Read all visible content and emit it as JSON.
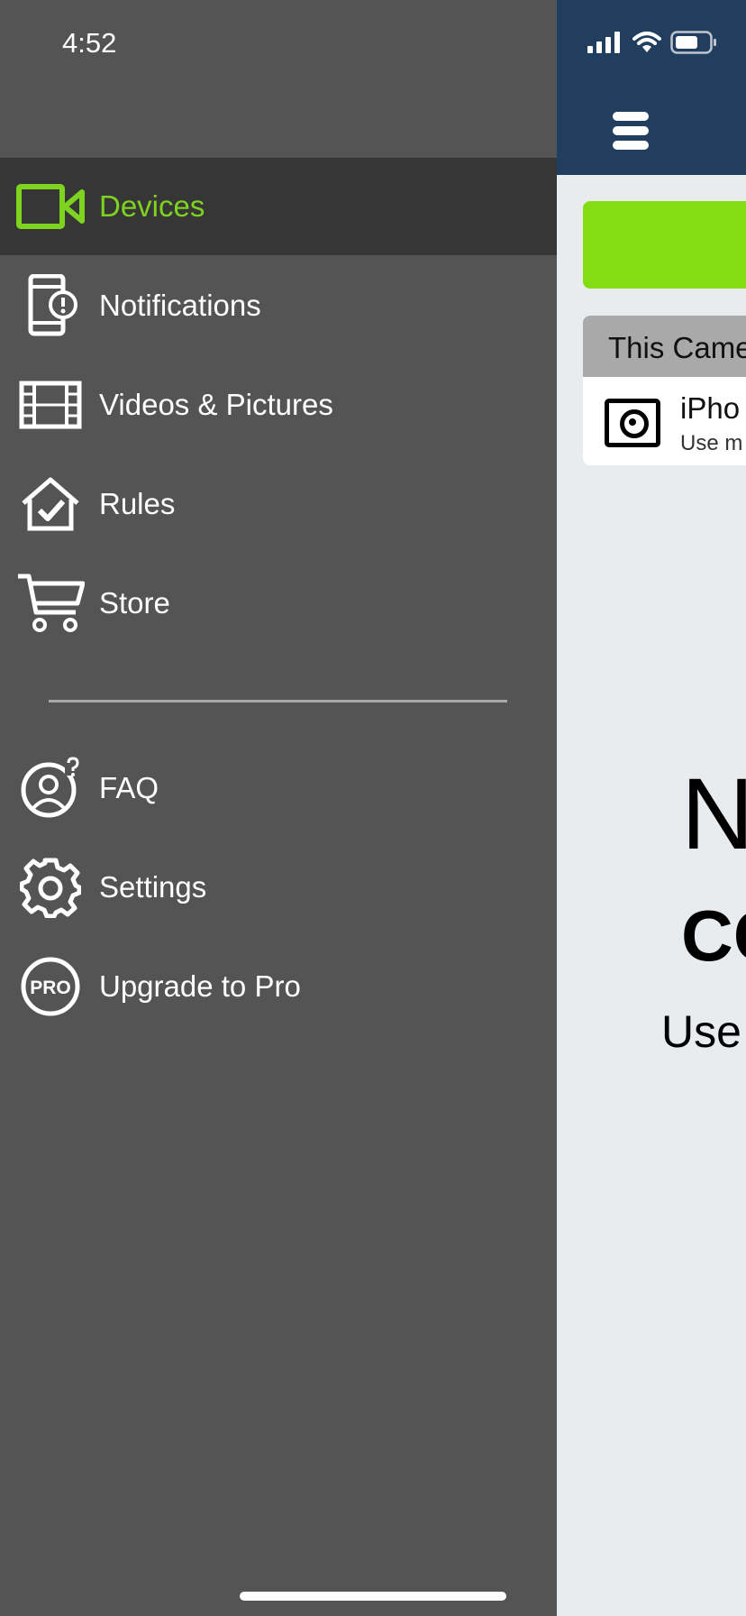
{
  "status_bar": {
    "time": "4:52"
  },
  "drawer": {
    "items": [
      {
        "label": "Devices",
        "icon": "video-camera-icon",
        "active": true
      },
      {
        "label": "Notifications",
        "icon": "phone-alert-icon"
      },
      {
        "label": "Videos & Pictures",
        "icon": "film-strip-icon"
      },
      {
        "label": "Rules",
        "icon": "house-check-icon"
      },
      {
        "label": "Store",
        "icon": "cart-icon"
      }
    ],
    "secondary_items": [
      {
        "label": "FAQ",
        "icon": "user-question-icon"
      },
      {
        "label": "Settings",
        "icon": "gear-icon"
      },
      {
        "label": "Upgrade to Pro",
        "icon": "pro-badge-icon",
        "badge_text": "PRO"
      }
    ]
  },
  "app": {
    "card_header": "This Came",
    "camera_name": "iPho",
    "camera_desc": "Use m",
    "big_text_1": "N",
    "big_text_2": "CC",
    "big_text_3": "Use"
  },
  "colors": {
    "accent": "#7ed321",
    "header": "#223e5f",
    "drawer": "#545454",
    "active_row": "#363636"
  }
}
